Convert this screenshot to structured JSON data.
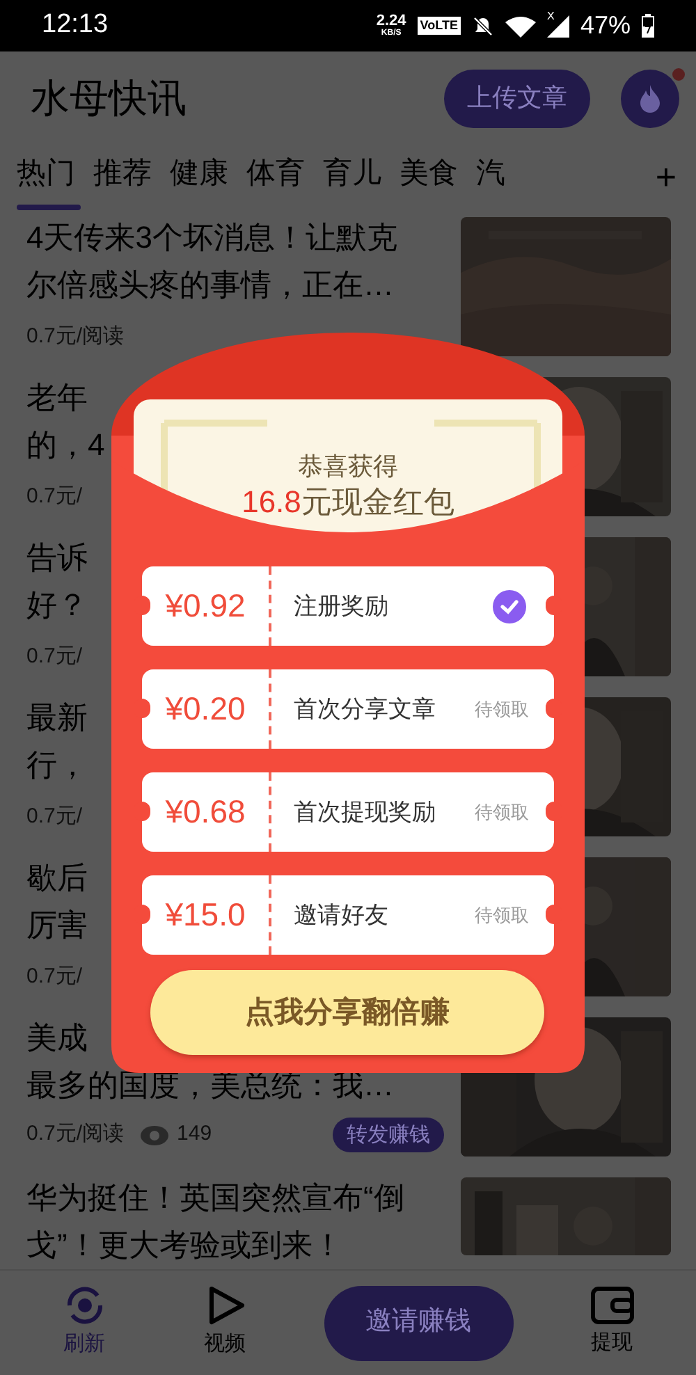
{
  "status_bar": {
    "time": "12:13",
    "speed": "2.24",
    "speed_unit": "KB/S",
    "volte": "VoLTE",
    "signal_mark": "X",
    "battery": "47%"
  },
  "header": {
    "title": "水母快讯",
    "upload_button": "上传文章",
    "notification_dot": true
  },
  "tabs": [
    {
      "label": "热门",
      "selected": true
    },
    {
      "label": "推荐",
      "selected": false
    },
    {
      "label": "健康",
      "selected": false
    },
    {
      "label": "体育",
      "selected": false
    },
    {
      "label": "育儿",
      "selected": false
    },
    {
      "label": "美食",
      "selected": false
    },
    {
      "label": "汽",
      "selected": false
    }
  ],
  "add_tab": "+",
  "articles": [
    {
      "title_lines": [
        "4天传来3个坏消息！让默克",
        "尔倍感头疼的事情，正在…"
      ],
      "price": "0.7元/阅读"
    },
    {
      "title_lines": [
        "老年",
        "的，4"
      ],
      "price": "0.7元/"
    },
    {
      "title_lines": [
        "告诉",
        "好？"
      ],
      "price": "0.7元/"
    },
    {
      "title_lines": [
        "最新",
        "行，"
      ],
      "price": "0.7元/"
    },
    {
      "title_lines": [
        "歇后",
        "厉害"
      ],
      "price": "0.7元/"
    },
    {
      "title_lines": [
        "美成",
        "最多的国度，美总统：我…"
      ],
      "price": "0.7元/阅读",
      "views": "149",
      "share_badge": "转发赚钱"
    },
    {
      "title_lines": [
        "华为挺住！英国突然宣布“倒",
        "戈”！更大考验或到来！"
      ]
    }
  ],
  "bottom_nav": [
    {
      "label": "刷新",
      "kind": "refresh",
      "selected": true
    },
    {
      "label": "视频",
      "kind": "video",
      "selected": false
    },
    {
      "label": "邀请赚钱",
      "kind": "invite",
      "selected": false
    },
    {
      "label": "提现",
      "kind": "wallet",
      "selected": false
    }
  ],
  "modal": {
    "heading": "恭喜获得",
    "amount": "16.8",
    "amount_suffix": "元现金红包",
    "rewards": [
      {
        "amount": "¥0.92",
        "label": "注册奖励",
        "claimed": true
      },
      {
        "amount": "¥0.20",
        "label": "首次分享文章",
        "claimed": false,
        "status": "待领取"
      },
      {
        "amount": "¥0.68",
        "label": "首次提现奖励",
        "claimed": false,
        "status": "待领取"
      },
      {
        "amount": "¥15.0",
        "label": "邀请好友",
        "claimed": false,
        "status": "待领取"
      }
    ],
    "share_button": "点我分享翻倍赚"
  }
}
